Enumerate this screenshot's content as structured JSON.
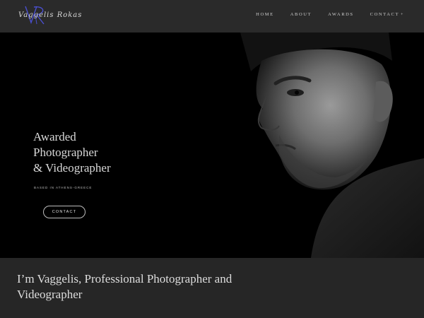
{
  "header": {
    "logo_text": "Vaggelis Rokas",
    "nav": {
      "home": "HOME",
      "about": "ABOUT",
      "awards": "AWARDS",
      "contact": "CONTACT"
    },
    "contact_caret": "+"
  },
  "hero": {
    "title_line1": "Awarded",
    "title_line2": "Photographer",
    "title_line3": "& Videographer",
    "subtitle": "BASED IN ATHENS-GREECE",
    "button_label": "CONTACT"
  },
  "intro": {
    "heading": "I’m Vaggelis, Professional Photographer and Videographer"
  },
  "colors": {
    "background": "#262626",
    "header": "#2a2a2a",
    "hero": "#000000",
    "logo_accent": "#4a4fd0",
    "text": "#dedede"
  },
  "icons": {
    "logo": "vr-monogram-logo",
    "caret": "plus-caret-icon"
  }
}
